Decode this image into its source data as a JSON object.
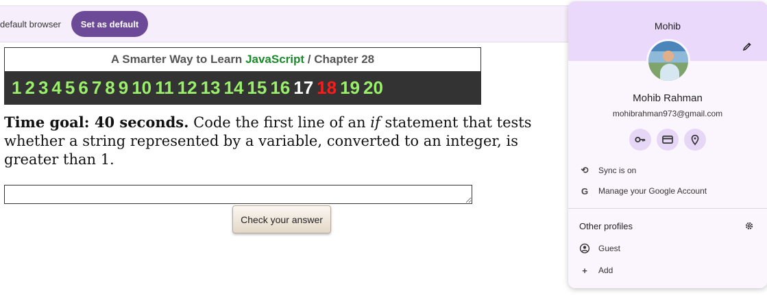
{
  "infobar": {
    "text": "default browser",
    "button_label": "Set as default"
  },
  "chapter": {
    "prefix": "A Smarter Way to Learn",
    "brand": "JavaScript",
    "separator": "/",
    "chapter_label": "Chapter 28",
    "numbers": [
      "1",
      "2",
      "3",
      "4",
      "5",
      "6",
      "7",
      "8",
      "9",
      "10",
      "11",
      "12",
      "13",
      "14",
      "15",
      "16",
      "17",
      "18",
      "19",
      "20"
    ],
    "current_number": "17",
    "target_number": "18"
  },
  "question": {
    "goal": "Time goal: 40 seconds.",
    "text_before": "Code the first line of an",
    "keyword": "if",
    "text_after": "statement that tests whether a string represented by a variable, converted to an integer, is greater than 1."
  },
  "answer": {
    "value": "",
    "button_label": "Check your answer"
  },
  "profile": {
    "header_name": "Mohib",
    "full_name": "Mohib Rahman",
    "email": "mohibrahman973@gmail.com",
    "quick_icons": [
      "key-icon",
      "credit-card-icon",
      "location-pin-icon"
    ],
    "sync_label": "Sync is on",
    "manage_label": "Manage your Google Account",
    "other_profiles_label": "Other profiles",
    "guest_label": "Guest",
    "add_label": "Add"
  },
  "colors": {
    "accent": "#6d4a97",
    "nav_numbers": "#9af06a",
    "nav_current": "#ffffff",
    "nav_target": "#ff1a1a",
    "brand_green": "#1a8a2a"
  }
}
